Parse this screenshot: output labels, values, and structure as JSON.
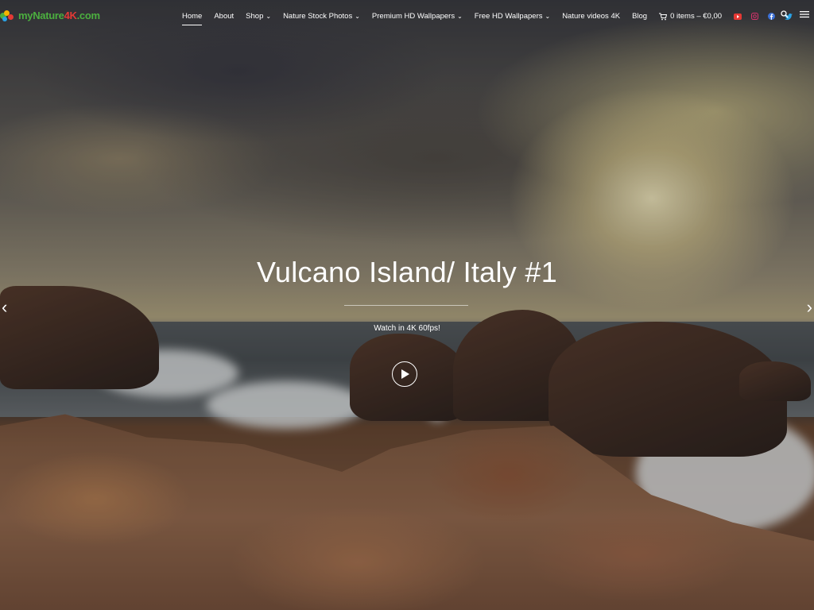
{
  "logo": {
    "part_a": "myNature",
    "part_b": "4K",
    "part_c": ".com"
  },
  "nav": {
    "items": [
      {
        "label": "Home",
        "active": true,
        "dropdown": false
      },
      {
        "label": "About",
        "active": false,
        "dropdown": false
      },
      {
        "label": "Shop",
        "active": false,
        "dropdown": true
      },
      {
        "label": "Nature Stock Photos",
        "active": false,
        "dropdown": true
      },
      {
        "label": "Premium HD Wallpapers",
        "active": false,
        "dropdown": true
      },
      {
        "label": "Free HD Wallpapers",
        "active": false,
        "dropdown": true
      },
      {
        "label": "Nature videos 4K",
        "active": false,
        "dropdown": false
      },
      {
        "label": "Blog",
        "active": false,
        "dropdown": false
      }
    ],
    "cart_label": "0 items – €0,00",
    "chevron": "⌄"
  },
  "social": [
    {
      "icon": "youtube-icon",
      "color": "#e53935"
    },
    {
      "icon": "instagram-icon",
      "color": "#d6336c"
    },
    {
      "icon": "facebook-icon",
      "color": "#3b6fd6"
    },
    {
      "icon": "twitter-icon",
      "color": "#29a3e6"
    }
  ],
  "hero": {
    "title": "Vulcano Island/ Italy #1",
    "subtitle": "Watch in 4K 60fps!",
    "prev_arrow": "‹",
    "next_arrow": "›"
  },
  "colors": {
    "logo_green": "#4caf3f",
    "logo_red": "#e53935",
    "text": "#ffffff"
  }
}
